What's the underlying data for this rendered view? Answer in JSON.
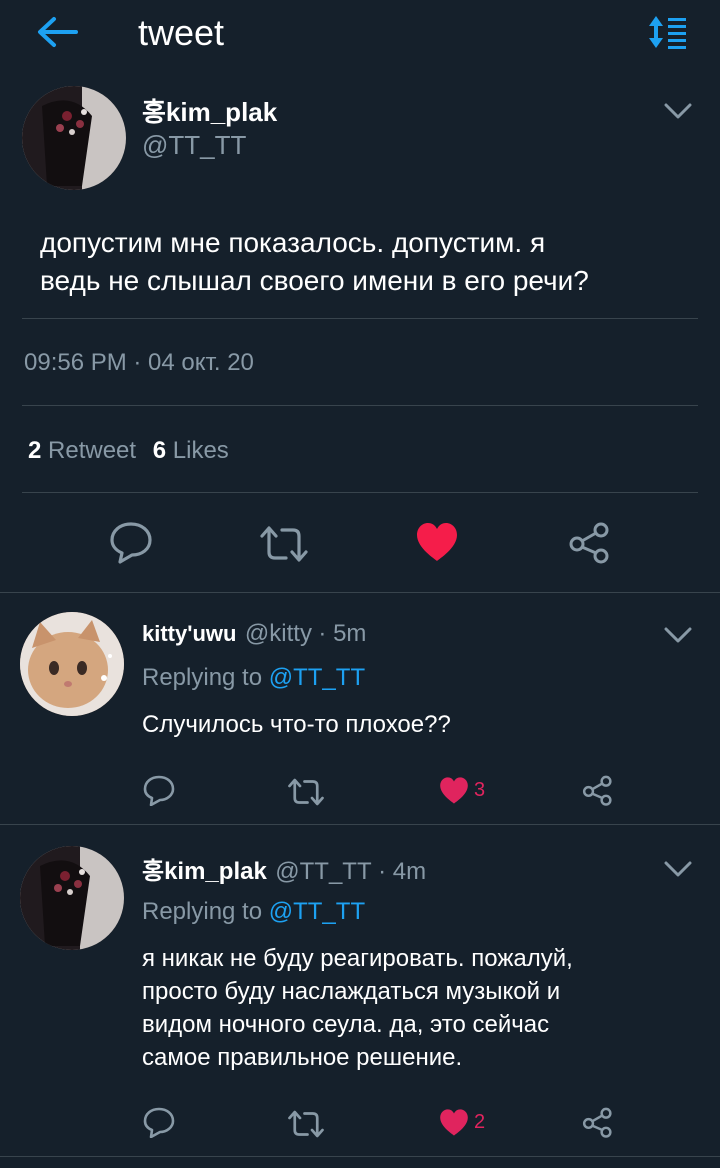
{
  "header": {
    "title": "tweet"
  },
  "main_tweet": {
    "display_name": "홍kim_plak",
    "handle": "@TT_TT",
    "text_line1": "допустим мне показалось. допустим. я",
    "text_line2": "ведь не слышал своего имени в его речи?",
    "timestamp": "09:56 PM · 04 окт. 20",
    "retweet_count": "2",
    "retweet_label": "Retweet",
    "likes_count": "6",
    "likes_label": "Likes",
    "liked": true
  },
  "replies": [
    {
      "display_name": "kitty'uwu",
      "handle": "@kitty",
      "time": "· 5m",
      "replying_label": "Replying to",
      "replying_to": "@TT_TT",
      "text_lines": [
        "Случилось что-то плохое??"
      ],
      "like_count": "3"
    },
    {
      "display_name": "홍kim_plak",
      "handle": "@TT_TT",
      "time": "· 4m",
      "replying_label": "Replying to",
      "replying_to": "@TT_TT",
      "text_lines": [
        "я никак не буду реагировать. пожалуй,",
        "просто буду наслаждаться музыкой и",
        "видом ночного сеула. да, это сейчас",
        "самое правильное решение."
      ],
      "like_count": "2"
    }
  ],
  "colors": {
    "background": "#15202b",
    "accent": "#1da1f2",
    "like": "#e0245e",
    "muted": "#8899a6"
  },
  "icons": [
    "back-arrow-icon",
    "sort-icon",
    "chevron-down-icon",
    "reply-icon",
    "retweet-icon",
    "heart-icon",
    "share-icon"
  ]
}
